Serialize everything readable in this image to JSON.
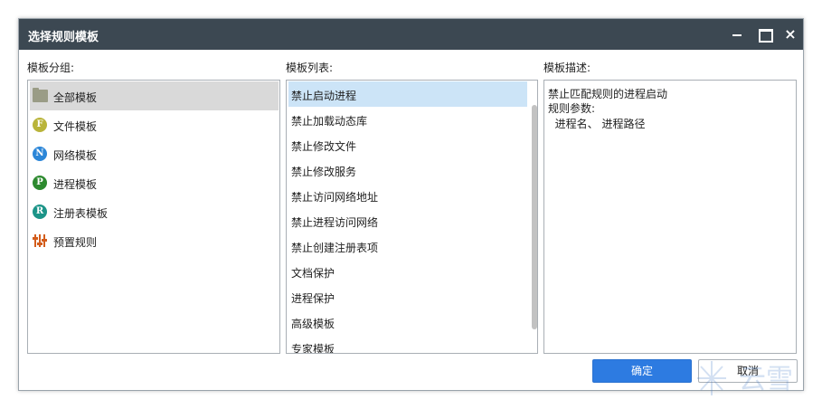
{
  "window": {
    "title": "选择规则模板",
    "close_glyph": "×"
  },
  "labels": {
    "group": "模板分组:",
    "list": "模板列表:",
    "desc": "模板描述:"
  },
  "groups": [
    {
      "label": "全部模板",
      "icon": "folder-icon",
      "selected": true
    },
    {
      "label": "文件模板",
      "icon": "f-badge-icon",
      "glyph": "F"
    },
    {
      "label": "网络模板",
      "icon": "n-badge-icon",
      "glyph": "N"
    },
    {
      "label": "进程模板",
      "icon": "p-badge-icon",
      "glyph": "P"
    },
    {
      "label": "注册表模板",
      "icon": "r-badge-icon",
      "glyph": "R"
    },
    {
      "label": "预置规则",
      "icon": "sliders-icon"
    }
  ],
  "templates": [
    {
      "label": "禁止启动进程",
      "selected": true
    },
    {
      "label": "禁止加载动态库"
    },
    {
      "label": "禁止修改文件"
    },
    {
      "label": "禁止修改服务"
    },
    {
      "label": "禁止访问网络地址"
    },
    {
      "label": "禁止进程访问网络"
    },
    {
      "label": "禁止创建注册表项"
    },
    {
      "label": "文档保护"
    },
    {
      "label": "进程保护"
    },
    {
      "label": "高级模板"
    },
    {
      "label": "专家模板"
    }
  ],
  "description": {
    "line1": "禁止匹配规则的进程启动",
    "line2": "规则参数:",
    "line3": "  进程名、 进程路径"
  },
  "buttons": {
    "ok": "确定",
    "cancel": "取消"
  },
  "watermark": {
    "text": "云雪"
  },
  "colors": {
    "titlebar": "#3c4852",
    "primary_button": "#2d7be1",
    "selected_list": "#cce4f7",
    "selected_group": "#d9d9d9"
  }
}
